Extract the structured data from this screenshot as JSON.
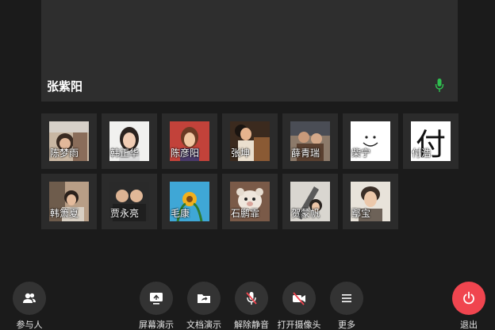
{
  "main_video": {
    "speaker_name": "张紫阳",
    "mic_color": "#2fbf4f"
  },
  "participants": [
    {
      "name": "陈梦雨",
      "avatar": "photo-avatar-1"
    },
    {
      "name": "韩正华",
      "avatar": "photo-avatar-2"
    },
    {
      "name": "陈彦阳",
      "avatar": "photo-avatar-3"
    },
    {
      "name": "张坤",
      "avatar": "photo-avatar-4"
    },
    {
      "name": "薛青瑞",
      "avatar": "photo-avatar-5"
    },
    {
      "name": "柴宁",
      "avatar": "smiley-avatar"
    },
    {
      "name": "付浩",
      "avatar": "character-avatar",
      "glyph": "付"
    },
    {
      "name": "韩箫夏",
      "avatar": "photo-avatar-8"
    },
    {
      "name": "贾永亮",
      "avatar": "photo-avatar-9"
    },
    {
      "name": "毛康",
      "avatar": "photo-avatar-10"
    },
    {
      "name": "石鹏霏",
      "avatar": "photo-avatar-11"
    },
    {
      "name": "贺蒙帆",
      "avatar": "photo-avatar-12"
    },
    {
      "name": "鄢宝",
      "avatar": "photo-avatar-13"
    }
  ],
  "toolbar": {
    "participants_label": "参与人",
    "screen_share_label": "屏幕演示",
    "doc_share_label": "文档演示",
    "unmute_label": "解除静音",
    "camera_on_label": "打开摄像头",
    "more_label": "更多",
    "exit_label": "退出",
    "exit_color": "#f0454f"
  }
}
